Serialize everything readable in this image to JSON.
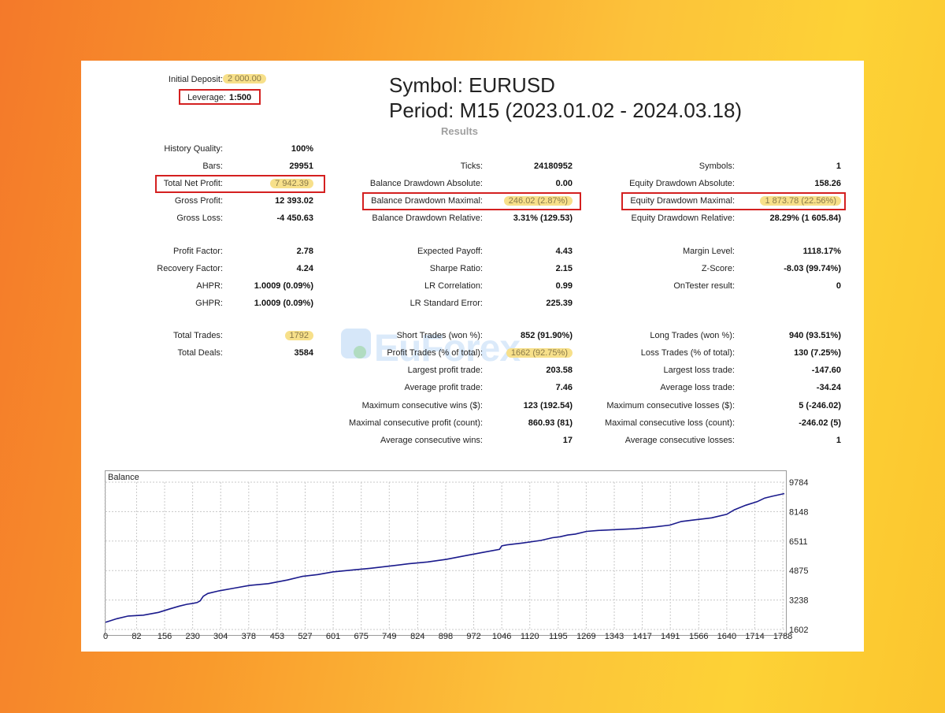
{
  "header": {
    "initial_deposit_label": "Initial Deposit:",
    "initial_deposit_value": "2 000.00",
    "leverage_label": "Leverage:",
    "leverage_value": "1:500",
    "symbol_line": "Symbol:  EURUSD",
    "period_line": "Period:  M15 (2023.01.02 - 2024.03.18)",
    "results_heading": "Results"
  },
  "col1": [
    {
      "label": "History Quality:",
      "value": "100%"
    },
    {
      "label": "Bars:",
      "value": "29951"
    },
    {
      "label": "Total Net Profit:",
      "value": "7 942.39"
    },
    {
      "label": "Gross Profit:",
      "value": "12 393.02"
    },
    {
      "label": "Gross Loss:",
      "value": "-4 450.63"
    },
    {
      "label": "Profit Factor:",
      "value": "2.78"
    },
    {
      "label": "Recovery Factor:",
      "value": "4.24"
    },
    {
      "label": "AHPR:",
      "value": "1.0009 (0.09%)"
    },
    {
      "label": "GHPR:",
      "value": "1.0009 (0.09%)"
    },
    {
      "label": "Total Trades:",
      "value": "1792"
    },
    {
      "label": "Total Deals:",
      "value": "3584"
    }
  ],
  "col2": [
    {
      "label": "Ticks:",
      "value": "24180952"
    },
    {
      "label": "Balance Drawdown Absolute:",
      "value": "0.00"
    },
    {
      "label": "Balance Drawdown Maximal:",
      "value": "246.02 (2.87%)"
    },
    {
      "label": "Balance Drawdown Relative:",
      "value": "3.31% (129.53)"
    },
    {
      "label": "Expected Payoff:",
      "value": "4.43"
    },
    {
      "label": "Sharpe Ratio:",
      "value": "2.15"
    },
    {
      "label": "LR Correlation:",
      "value": "0.99"
    },
    {
      "label": "LR Standard Error:",
      "value": "225.39"
    },
    {
      "label": "Short Trades (won %):",
      "value": "852 (91.90%)"
    },
    {
      "label": "Profit Trades (% of total):",
      "value": "1662 (92.75%)"
    },
    {
      "label": "Largest profit trade:",
      "value": "203.58"
    },
    {
      "label": "Average profit trade:",
      "value": "7.46"
    },
    {
      "label": "Maximum consecutive wins ($):",
      "value": "123 (192.54)"
    },
    {
      "label": "Maximal consecutive profit (count):",
      "value": "860.93 (81)"
    },
    {
      "label": "Average consecutive wins:",
      "value": "17"
    }
  ],
  "col3": [
    {
      "label": "Symbols:",
      "value": "1"
    },
    {
      "label": "Equity Drawdown Absolute:",
      "value": "158.26"
    },
    {
      "label": "Equity Drawdown Maximal:",
      "value": "1 873.78 (22.56%)"
    },
    {
      "label": "Equity Drawdown Relative:",
      "value": "28.29% (1 605.84)"
    },
    {
      "label": "Margin Level:",
      "value": "1118.17%"
    },
    {
      "label": "Z-Score:",
      "value": "-8.03 (99.74%)"
    },
    {
      "label": "OnTester result:",
      "value": "0"
    },
    {
      "label": "Long Trades (won %):",
      "value": "940 (93.51%)"
    },
    {
      "label": "Loss Trades (% of total):",
      "value": "130 (7.25%)"
    },
    {
      "label": "Largest loss trade:",
      "value": "-147.60"
    },
    {
      "label": "Average loss trade:",
      "value": "-34.24"
    },
    {
      "label": "Maximum consecutive losses ($):",
      "value": "5 (-246.02)"
    },
    {
      "label": "Maximal consecutive loss (count):",
      "value": "-246.02 (5)"
    },
    {
      "label": "Average consecutive losses:",
      "value": "1"
    }
  ],
  "watermark": "EuForex",
  "colors": {
    "highlight": "#f7e08a",
    "red_box": "#d42020",
    "balance_line": "#1a1a8c"
  },
  "chart_data": {
    "type": "line",
    "title": "Balance",
    "x_ticks": [
      "0",
      "82",
      "156",
      "230",
      "304",
      "378",
      "453",
      "527",
      "601",
      "675",
      "749",
      "824",
      "898",
      "972",
      "1046",
      "1120",
      "1195",
      "1269",
      "1343",
      "1417",
      "1491",
      "1566",
      "1640",
      "1714",
      "1788"
    ],
    "y_ticks": [
      "1602",
      "3238",
      "4875",
      "6511",
      "8148",
      "9784"
    ],
    "xlim": [
      0,
      1792
    ],
    "ylim": [
      1602,
      9784
    ],
    "series": [
      {
        "x": [
          0,
          30,
          60,
          100,
          140,
          170,
          195,
          215,
          230,
          242,
          250,
          258,
          270,
          300,
          340,
          380,
          430,
          480,
          520,
          560,
          600,
          650,
          700,
          760,
          800,
          850,
          900,
          950,
          1000,
          1040,
          1046,
          1060,
          1100,
          1150,
          1180,
          1200,
          1220,
          1240,
          1270,
          1300,
          1350,
          1400,
          1450,
          1490,
          1520,
          1560,
          1600,
          1640,
          1660,
          1690,
          1720,
          1740,
          1760,
          1792
        ],
        "y": [
          2000,
          2200,
          2350,
          2400,
          2550,
          2750,
          2900,
          3000,
          3050,
          3100,
          3200,
          3450,
          3600,
          3750,
          3900,
          4050,
          4150,
          4350,
          4550,
          4650,
          4800,
          4900,
          5000,
          5150,
          5250,
          5350,
          5500,
          5700,
          5900,
          6050,
          6250,
          6300,
          6400,
          6550,
          6700,
          6750,
          6850,
          6900,
          7050,
          7100,
          7150,
          7200,
          7300,
          7400,
          7600,
          7700,
          7800,
          8000,
          8250,
          8500,
          8700,
          8900,
          9000,
          9150
        ]
      }
    ]
  }
}
